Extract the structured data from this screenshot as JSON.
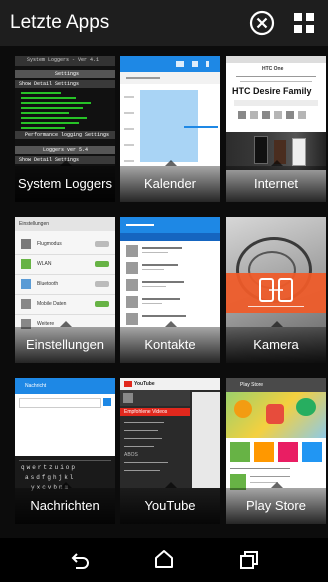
{
  "header": {
    "title": "Letzte Apps"
  },
  "apps": [
    {
      "label": "System Loggers"
    },
    {
      "label": "Kalender"
    },
    {
      "label": "Internet"
    },
    {
      "label": "Einstellungen"
    },
    {
      "label": "Kontakte"
    },
    {
      "label": "Kamera"
    },
    {
      "label": "Nachrichten"
    },
    {
      "label": "YouTube"
    },
    {
      "label": "Play Store"
    }
  ],
  "thumb_text": {
    "loggers_top": "System Loggers - Ver 4.1",
    "loggers_menu": "Settings",
    "loggers_show": "Show Detail Settings",
    "loggers_perf": "Performance logging Settings",
    "loggers_ver": "Loggers ver 5.4",
    "loggers_show2": "Show Detail Settings",
    "internet_site": "HTC One",
    "internet_heading": "HTC Desire Family",
    "settings_title": "Einstellungen",
    "settings_flight": "Flugmodus",
    "settings_wlan": "WLAN",
    "settings_bt": "Bluetooth",
    "settings_mobile": "Mobile Daten",
    "settings_more": "Weitere",
    "youtube_brand": "YouTube",
    "youtube_subs": "Empfohlene Videos",
    "youtube_section": "ABOS",
    "play_brand": "Play Store",
    "msg_title": "Nachricht"
  },
  "colors": {
    "header_bg": "#1e1e1e",
    "background": "#0c0c0c",
    "accent_blue": "#1e88e5",
    "accent_red": "#e1281d",
    "accent_orange": "#f05a28",
    "play_green": "#67b345"
  },
  "icons": {
    "close": "close-icon",
    "grid": "grid-icon",
    "back": "back-icon",
    "home": "home-icon",
    "recents": "recents-icon"
  }
}
